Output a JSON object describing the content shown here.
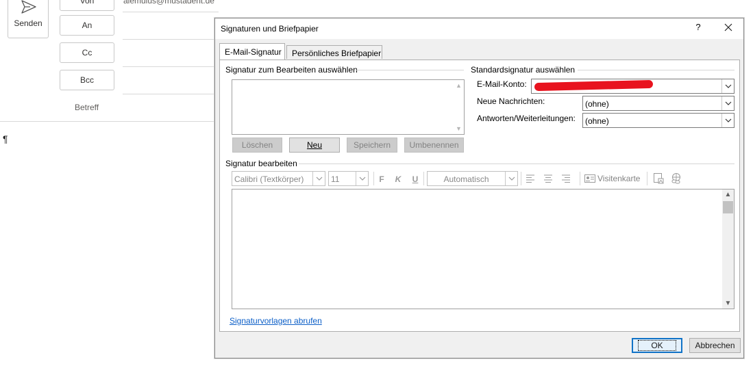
{
  "compose": {
    "send_label": "Senden",
    "from_label": "Von",
    "from_address": "alemulus@mustadent.de",
    "to_label": "An",
    "cc_label": "Cc",
    "bcc_label": "Bcc",
    "subject_label": "Betreff",
    "body_mark": "¶"
  },
  "dialog": {
    "title": "Signaturen und Briefpapier",
    "help": "?",
    "tabs": [
      {
        "label": "E-Mail-Signatur",
        "active": true
      },
      {
        "label": "Persönliches Briefpapier",
        "active": false
      }
    ],
    "select_group": {
      "label": "Signatur zum Bearbeiten auswählen",
      "buttons": {
        "delete": "Löschen",
        "new": "Neu",
        "save": "Speichern",
        "rename": "Umbenennen"
      }
    },
    "default_group": {
      "label": "Standardsignatur auswählen",
      "account_label": "E-Mail-Konto:",
      "new_messages_label": "Neue Nachrichten:",
      "new_messages_value": "(ohne)",
      "replies_label": "Antworten/Weiterleitungen:",
      "replies_value": "(ohne)"
    },
    "edit_group": {
      "label": "Signatur bearbeiten",
      "font_value": "Calibri (Textkörper)",
      "size_value": "11",
      "bold": "F",
      "italic": "K",
      "underline": "U",
      "color_value": "Automatisch",
      "business_card": "Visitenkarte"
    },
    "template_link": "Signaturvorlagen abrufen",
    "ok_label": "OK",
    "cancel_label": "Abbrechen"
  },
  "colors": {
    "redaction": "#e8131e",
    "link": "#0b5ec7",
    "ok_border": "#1173c7"
  }
}
